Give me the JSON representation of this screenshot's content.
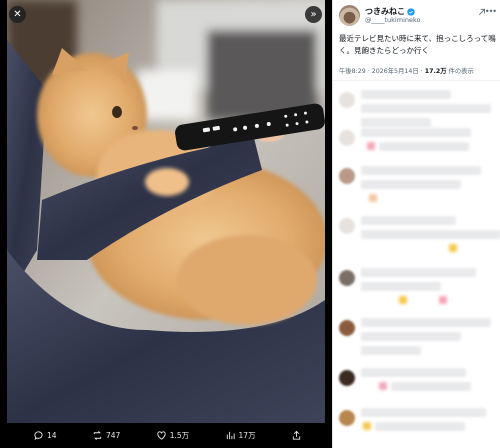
{
  "viewer": {
    "close_icon": "close-icon",
    "next_icon": "chevron-right-icon"
  },
  "actions": {
    "reply_count": "14",
    "repost_count": "747",
    "like_count": "1.5万",
    "view_count": "17万"
  },
  "author": {
    "display_name": "つきみねこ",
    "handle": "@____tukimineko",
    "verified_color": "#1d9bf0"
  },
  "tweet": {
    "text": "最近テレビ見たい時に来て、抱っこしろって鳴く。見飽きたらどっか行く",
    "time": "午後8:29 · 2026年5月14日 · ",
    "views_number": "17.2万",
    "views_suffix": " 件の表示"
  },
  "colors": {
    "accent": "#1d9bf0",
    "viewer_bg": "#000000",
    "text_secondary": "#536471"
  }
}
